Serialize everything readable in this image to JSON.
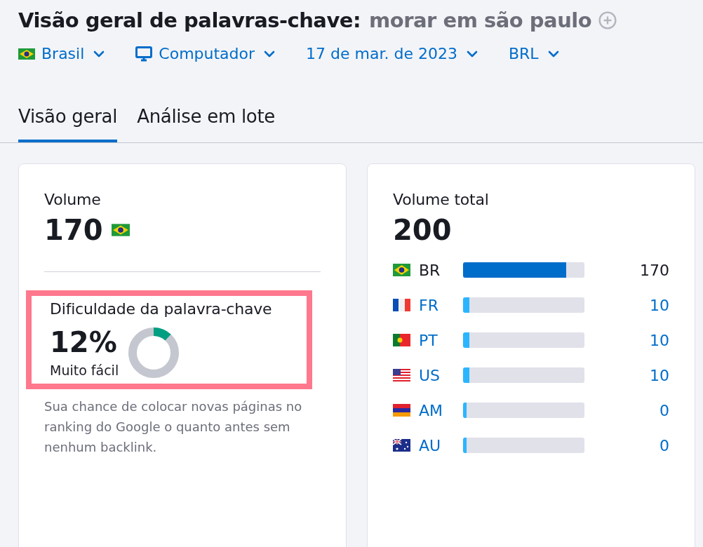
{
  "header": {
    "title": "Visão geral de palavras-chave:",
    "keyword": "morar em são paulo"
  },
  "filters": [
    {
      "kind": "country",
      "label": "Brasil"
    },
    {
      "kind": "device",
      "label": "Computador"
    },
    {
      "kind": "date",
      "label": "17 de mar. de 2023"
    },
    {
      "kind": "currency",
      "label": "BRL"
    }
  ],
  "tabs": [
    {
      "label": "Visão geral",
      "selected": true
    },
    {
      "label": "Análise em lote",
      "selected": false
    }
  ],
  "volume_card": {
    "label": "Volume",
    "value": "170",
    "difficulty": {
      "label": "Dificuldade da palavra-chave",
      "value": "12%",
      "rating": "Muito fácil",
      "highlighted": true
    },
    "description": "Sua chance de colocar novas páginas no ranking do Google o quanto antes sem nenhum backlink."
  },
  "total_card": {
    "label": "Volume total",
    "value": "200",
    "countries": [
      {
        "kind": "br",
        "code": "BR",
        "level": 0.85,
        "value": "170",
        "selected": true
      },
      {
        "kind": "fr",
        "code": "FR",
        "level": 0.05,
        "value": "10",
        "selected": false
      },
      {
        "kind": "pt",
        "code": "PT",
        "level": 0.05,
        "value": "10",
        "selected": false
      },
      {
        "kind": "us",
        "code": "US",
        "level": 0.05,
        "value": "10",
        "selected": false
      },
      {
        "kind": "am",
        "code": "AM",
        "level": 0.03,
        "value": "0",
        "selected": false
      },
      {
        "kind": "au",
        "code": "AU",
        "level": 0.03,
        "value": "0",
        "selected": false
      }
    ]
  }
}
